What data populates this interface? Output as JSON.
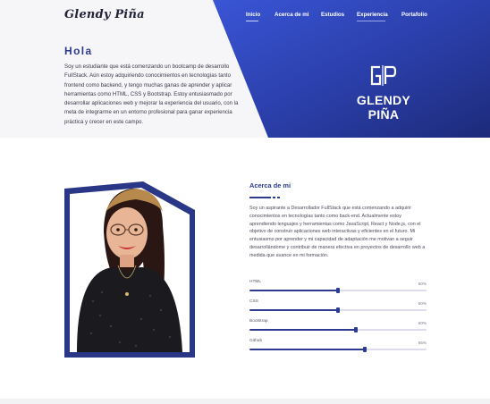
{
  "brand": {
    "logo_text": "Glendy Piña",
    "monogram": "GP",
    "name_block": "GLENDY PIÑA"
  },
  "nav": {
    "items": [
      {
        "label": "Inicio",
        "active": true
      },
      {
        "label": "Acerca de mi",
        "active": false
      },
      {
        "label": "Estudios",
        "active": false
      },
      {
        "label": "Experiencia",
        "active": true
      },
      {
        "label": "Portafolio",
        "active": false
      }
    ]
  },
  "hero": {
    "heading": "Hola",
    "text": "Soy un estudiante que está comenzando un bootcamp de desarrollo FullStack. Aún estoy adquiriendo conocimientos en tecnologías tanto frontend como backend, y tengo muchas ganas de aprender y aplicar herramientas como HTML, CSS y Bootstrap. Estoy entusiasmado por desarrollar aplicaciones web y mejorar la experiencia del usuario, con la meta de integrarme en un entorno profesional para ganar experiencia práctica y crecer en este campo."
  },
  "about": {
    "title": "Acerca de mi",
    "text": "Soy un aspirante a Desarrollador FullStack que está comenzando a adquirir conocimientos en tecnologías tanto como back-end. Actualmente estoy aprendiendo lenguajes y herramientas como JavaScript, React y Node.js, con el objetivo de construir aplicaciones web interactivas y eficientes en el futuro. Mi entusiasmo por aprender y mi capacidad de adaptación me motivan a seguir desarrollándome y contribuir de manera efectiva en proyectos de desarrollo web a medida que avance en mi formación."
  },
  "skills": [
    {
      "name": "HTML",
      "percent_label": "50%",
      "percent": 50
    },
    {
      "name": "CSS",
      "percent_label": "50%",
      "percent": 50
    },
    {
      "name": "Bootstrap",
      "percent_label": "60%",
      "percent": 60
    },
    {
      "name": "Github",
      "percent_label": "65%",
      "percent": 65
    }
  ],
  "colors": {
    "primary": "#2c3a8f",
    "hero_gradient_start": "#3048c8",
    "hero_gradient_end": "#1c2a78",
    "page_bg": "#ffffff"
  }
}
